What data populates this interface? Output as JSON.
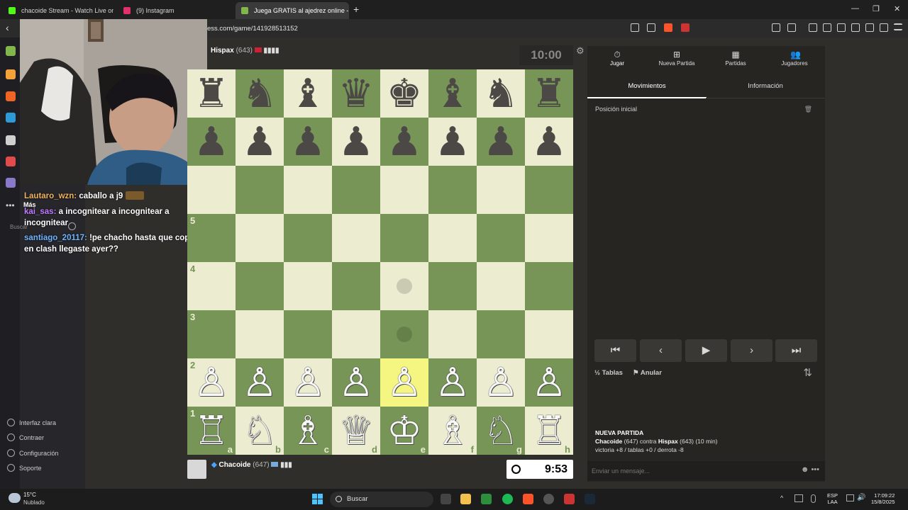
{
  "browser": {
    "tabs": [
      {
        "title": "chacoide Stream - Watch Live on",
        "icon_color": "#53fc18"
      },
      {
        "title": "(9) Instagram",
        "icon_color": "#e1306c"
      },
      {
        "title": "Juega GRATIS al ajedrez online -",
        "icon_color": "#81b64c"
      }
    ],
    "url": "ess.com/game/141928513152",
    "new_tab_glyph": "+",
    "close_glyph": "×"
  },
  "stream_chat": [
    {
      "user": "Lautaro_wzn:",
      "message": "caballo a j9",
      "user_color": "#f0b35e"
    },
    {
      "user": "kai_sas:",
      "message": "a incognitear a incognitear a incognitear",
      "user_color": "#c27cff"
    },
    {
      "user": "santiago_20117:",
      "message": "!pe chacho hasta que copas en clash llegaste ayer??",
      "user_color": "#6fb4ff"
    }
  ],
  "side_labels": {
    "mas": "Más",
    "buscar": "Buscar"
  },
  "left_menu": [
    {
      "label": "Interfaz clara",
      "icon": "half-circle-icon"
    },
    {
      "label": "Contraer",
      "icon": "collapse-icon"
    },
    {
      "label": "Configuración",
      "icon": "gear-icon"
    },
    {
      "label": "Soporte",
      "icon": "help-icon"
    }
  ],
  "opponent": {
    "name": "Hispax",
    "rating": "(643)",
    "clock": "10:00"
  },
  "player": {
    "name": "Chacoide",
    "rating": "(647)",
    "clock": "9:53"
  },
  "board": {
    "rows": [
      [
        "♜",
        "♞",
        "♝",
        "♛",
        "♚",
        "♝",
        "♞",
        "♜"
      ],
      [
        "♟",
        "♟",
        "♟",
        "♟",
        "♟",
        "♟",
        "♟",
        "♟"
      ],
      [
        "",
        "",
        "",
        "",
        "",
        "",
        "",
        ""
      ],
      [
        "",
        "",
        "",
        "",
        "",
        "",
        "",
        ""
      ],
      [
        "",
        "",
        "",
        "",
        "",
        "",
        "",
        ""
      ],
      [
        "",
        "",
        "",
        "",
        "",
        "",
        "",
        ""
      ],
      [
        "♙",
        "♙",
        "♙",
        "♙",
        "♙",
        "♙",
        "♙",
        "♙"
      ],
      [
        "♖",
        "♘",
        "♗",
        "♕",
        "♔",
        "♗",
        "♘",
        "♖"
      ]
    ],
    "rank_labels": [
      "",
      "",
      "",
      "5",
      "4",
      "3",
      "2",
      "1"
    ],
    "file_labels": [
      "a",
      "b",
      "c",
      "d",
      "e",
      "f",
      "g",
      "h"
    ],
    "highlight": {
      "row": 6,
      "col": 4
    },
    "move_dots": [
      {
        "row": 4,
        "col": 4
      },
      {
        "row": 5,
        "col": 4
      }
    ]
  },
  "panel": {
    "nav": [
      {
        "label": "Jugar",
        "icon": "stopwatch-icon"
      },
      {
        "label": "Nueva Partida",
        "icon": "plus-square-icon"
      },
      {
        "label": "Partidas",
        "icon": "board-icon"
      },
      {
        "label": "Jugadores",
        "icon": "players-icon"
      }
    ],
    "subtabs": {
      "moves": "Movimientos",
      "info": "Información"
    },
    "position_label": "Posición inicial",
    "draw_label": "Tablas",
    "abort_label": "Anular",
    "game_info": {
      "title": "NUEVA PARTIDA",
      "white": "Chacoide",
      "white_rating": "(647)",
      "vs": "contra",
      "black": "Hispax",
      "black_rating": "(643)",
      "time_control": "(10 min)",
      "outcomes": "victoria +8 / tablas +0 / derrota -8"
    },
    "chat_placeholder": "Enviar un mensaje..."
  },
  "taskbar": {
    "temperature": "15°C",
    "weather": "Nublado",
    "search": "Buscar",
    "lang_line1": "ESP",
    "lang_line2": "LAA",
    "time": "17:09:22",
    "date": "15/8/2025"
  }
}
